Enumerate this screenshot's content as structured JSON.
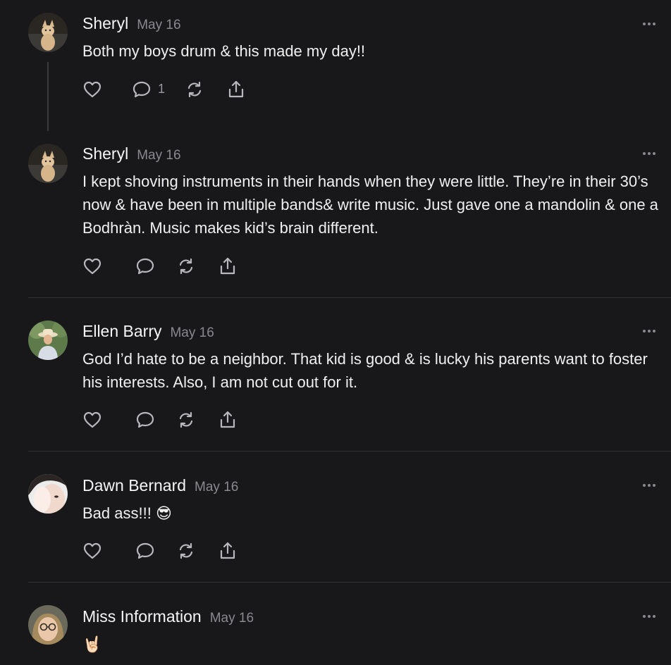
{
  "comments": [
    {
      "author": "Sheryl",
      "date": "May 16",
      "text": "Both my boys drum & this made my day!!",
      "reply_count": "1",
      "avatar": "dog-avatar"
    },
    {
      "author": "Sheryl",
      "date": "May 16",
      "text": "I kept shoving instruments in their hands when they were little. They’re in their 30’s now & have been in multiple bands& write music. Just gave one a mandolin & one a Bodhràn. Music makes kid’s brain different.",
      "reply_count": "",
      "avatar": "dog-avatar"
    },
    {
      "author": "Ellen Barry",
      "date": "May 16",
      "text": "God I’d hate to be a neighbor. That kid is good & is lucky his parents want to foster his interests. Also, I am not cut out for it.",
      "reply_count": "",
      "avatar": "hat-person-avatar"
    },
    {
      "author": "Dawn Bernard",
      "date": "May 16",
      "text": "Bad ass!!! 😎",
      "reply_count": "",
      "avatar": "face-avatar"
    },
    {
      "author": "Miss Information",
      "date": "May 16",
      "text": "🤘🏻",
      "reply_count": "",
      "avatar": "glasses-person-avatar"
    }
  ],
  "icons": {
    "like": "heart-icon",
    "reply": "comment-bubble-icon",
    "restack": "restack-icon",
    "share": "share-icon",
    "more": "more-dots-icon"
  },
  "colors": {
    "background": "#18181a",
    "text": "#f0f0f0",
    "muted": "#8a8a8e",
    "divider": "#333336"
  }
}
